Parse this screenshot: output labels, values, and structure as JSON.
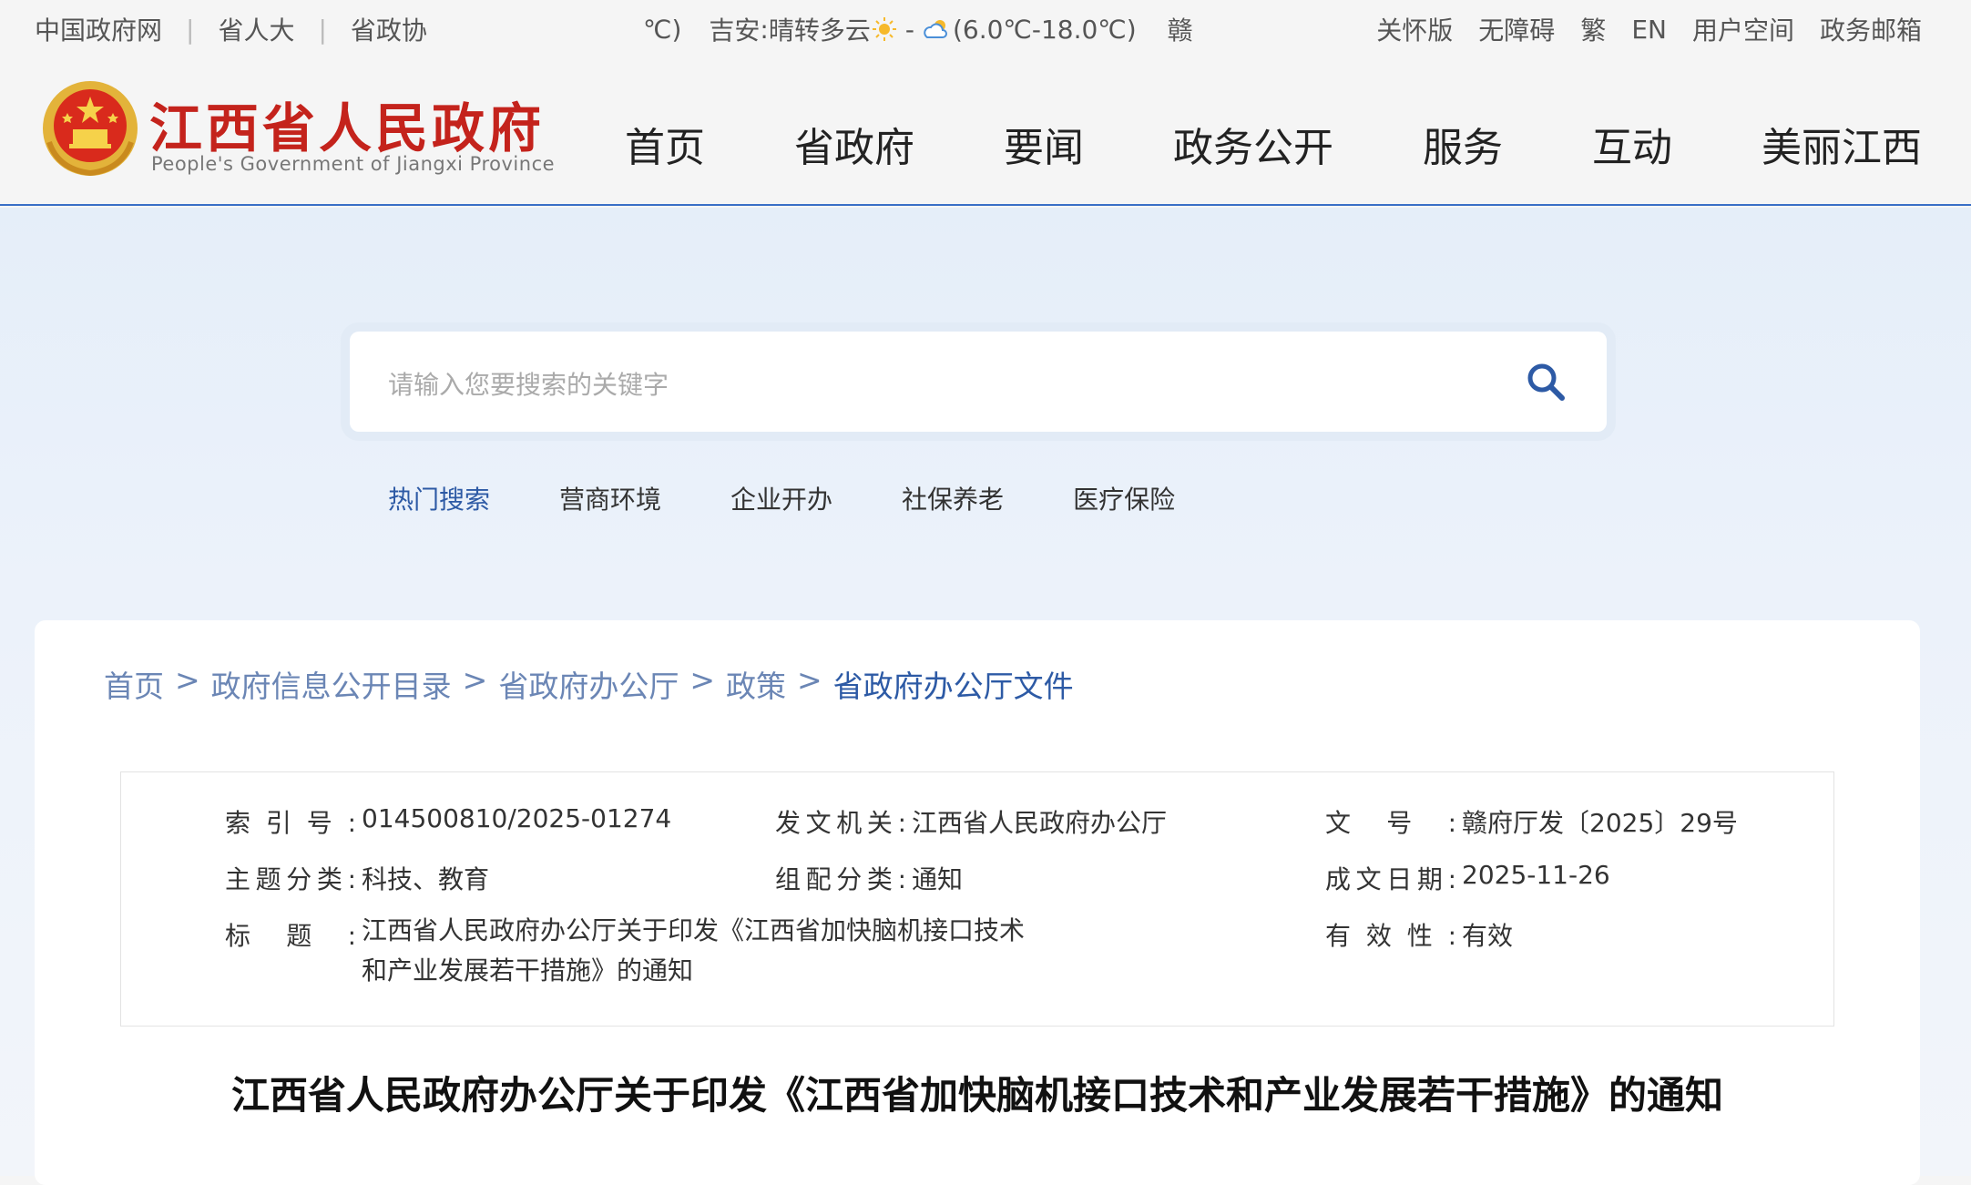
{
  "topbar": {
    "links": [
      "中国政府网",
      "省人大",
      "省政协"
    ],
    "weather": {
      "fragment": "℃)",
      "city": "吉安",
      "desc": "晴转多云",
      "dash": "-",
      "temp": "(6.0℃-18.0℃)",
      "abbr": "赣"
    },
    "right": [
      "关怀版",
      "无障碍",
      "繁",
      "EN",
      "用户空间",
      "政务邮箱"
    ]
  },
  "header": {
    "site_name": "江西省人民政府",
    "site_en": "People's Government of Jiangxi Province",
    "nav": [
      "首页",
      "省政府",
      "要闻",
      "政务公开",
      "服务",
      "互动",
      "美丽江西"
    ]
  },
  "search": {
    "placeholder": "请输入您要搜索的关键字",
    "hot_label": "热门搜索",
    "hot": [
      "营商环境",
      "企业开办",
      "社保养老",
      "医疗保险"
    ]
  },
  "breadcrumb": {
    "items": [
      "首页",
      "政府信息公开目录",
      "省政府办公厅",
      "政策",
      "省政府办公厅文件"
    ],
    "sep": ">"
  },
  "meta": {
    "index_no": {
      "label": "索引号:",
      "value": "014500810/2025-01274"
    },
    "issuer": {
      "label": "发文机关:",
      "value": "江西省人民政府办公厅"
    },
    "doc_no": {
      "label": "文号:",
      "value": "赣府厅发〔2025〕29号"
    },
    "topic": {
      "label": "主题分类:",
      "value": "科技、教育"
    },
    "category": {
      "label": "组配分类:",
      "value": "通知"
    },
    "date": {
      "label": "成文日期:",
      "value": "2025-11-26"
    },
    "title": {
      "label": "标题:",
      "value_line1": "江西省人民政府办公厅关于印发《江西省加快脑机接口技术",
      "value_line2": "和产业发展若干措施》的通知"
    },
    "validity": {
      "label": "有效性:",
      "value": "有效"
    }
  },
  "doc_title": "江西省人民政府办公厅关于印发《江西省加快脑机接口技术和产业发展若干措施》的通知",
  "colors": {
    "brand_red": "#c4231c",
    "link_blue": "#2d5aa5",
    "crumb_blue": "#6b86b5"
  }
}
